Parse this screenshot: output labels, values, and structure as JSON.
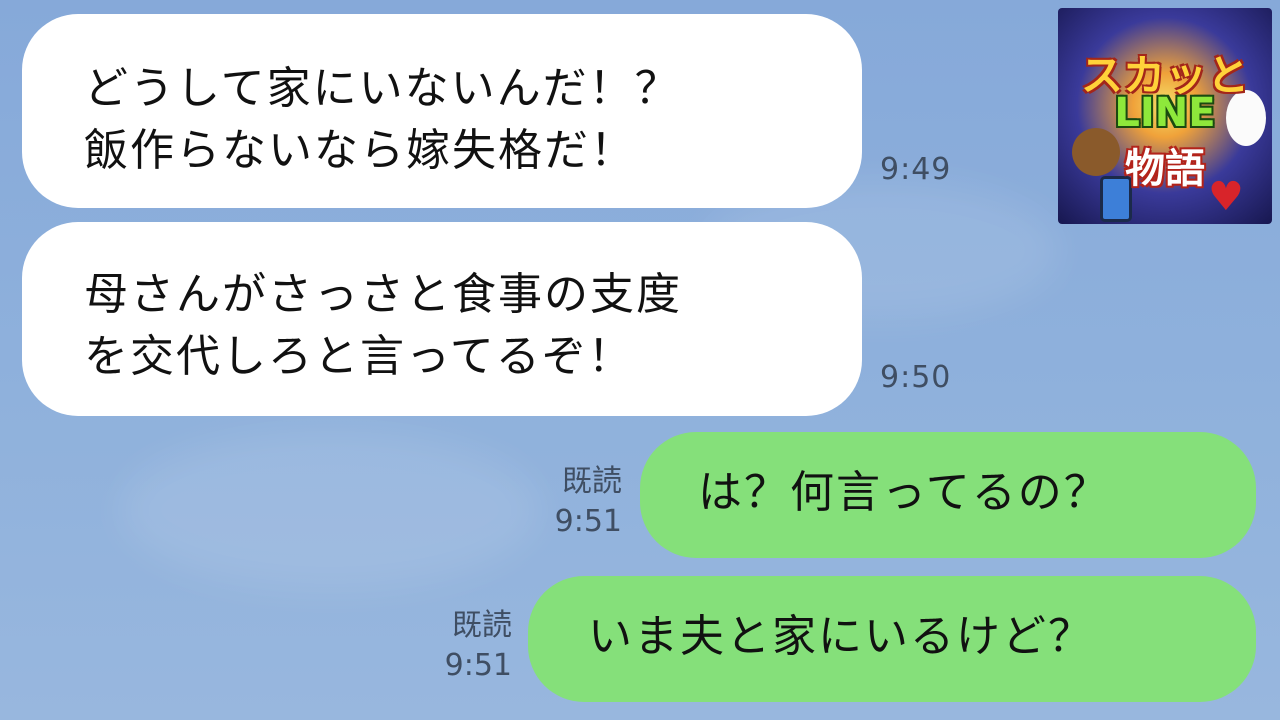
{
  "messages": [
    {
      "lines": [
        "どうして家にいないんだ！？",
        "飯作らないなら嫁失格だ！"
      ],
      "time": "9:49"
    },
    {
      "lines": [
        "母さんがさっさと食事の支度",
        "を交代しろと言ってるぞ！"
      ],
      "time": "9:50"
    },
    {
      "text": "は？何言ってるの？",
      "read": "既読",
      "time": "9:51"
    },
    {
      "text": "いま夫と家にいるけど？",
      "read": "既読",
      "time": "9:51"
    }
  ],
  "thumbnail": {
    "line1": "スカッと",
    "line2": "LINE",
    "line3": "物語"
  },
  "colors": {
    "incoming_bubble": "#ffffff",
    "outgoing_bubble": "#85e07a",
    "background": "#8fb1dc"
  },
  "icons": [
    "bear-icon",
    "bunny-icon",
    "broken-heart-icon",
    "phone-icon"
  ]
}
